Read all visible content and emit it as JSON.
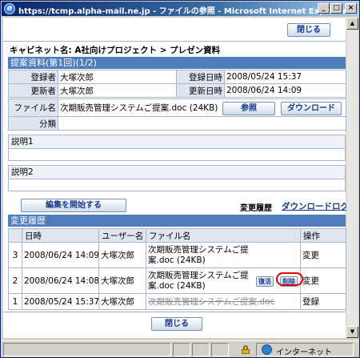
{
  "window": {
    "title": "https://tcmp.alpha-mail.ne.jp - ファイルの参照 - Microsoft Internet Explorer",
    "min_label": "_",
    "max_label": "□",
    "close_label": "×"
  },
  "top_close_label": "閉じる",
  "bottom_close_label": "閉じる",
  "breadcrumb": "キャビネット名: A社向けプロジェクト > プレゼン資料",
  "file_section": {
    "title": "提案資料(第1回)(1/2)",
    "registrant_label": "登録者",
    "registrant": "大塚次郎",
    "registered_at_label": "登録日時",
    "registered_at": "2008/05/24 15:37",
    "updater_label": "更新者",
    "updater": "大塚次郎",
    "updated_at_label": "更新日時",
    "updated_at": "2008/06/24 14:09",
    "filename_label": "ファイル名",
    "filename": "次期販売管理システムご提案.doc (24KB)",
    "browse_label": "参照",
    "download_label": "ダウンロード",
    "category_label": "分類",
    "category": ""
  },
  "description1_label": "説明1",
  "description2_label": "説明2",
  "edit_start_label": "編集を開始する",
  "history_text": "変更履歴",
  "download_log_label": "ダウンロードログ",
  "history": {
    "title": "変更履歴",
    "headers": [
      "",
      "日時",
      "ユーザー名",
      "ファイル名",
      "操作"
    ],
    "rows": [
      {
        "no": "3",
        "date": "2008/06/24 14:09",
        "user": "大塚次郎",
        "file1": "次期販売管理システムご提",
        "file2": "案.doc (24KB)",
        "op": "変更"
      },
      {
        "no": "2",
        "date": "2008/06/24 14:08",
        "user": "大塚次郎",
        "file1": "次期販売管理システムご提",
        "file2": "案.doc (24KB)",
        "op": "変更",
        "restore_label": "復活",
        "delete_label": "削除"
      },
      {
        "no": "1",
        "date": "2008/05/24 15:37",
        "user": "大塚次郎",
        "file1": "次期販売管理システムご提案.doc",
        "file2": "",
        "op": "登録"
      }
    ]
  },
  "status": {
    "zone_label": "インターネット"
  },
  "colors": {
    "section_header": "#4d7dbd",
    "highlight_ring": "#e00000"
  }
}
